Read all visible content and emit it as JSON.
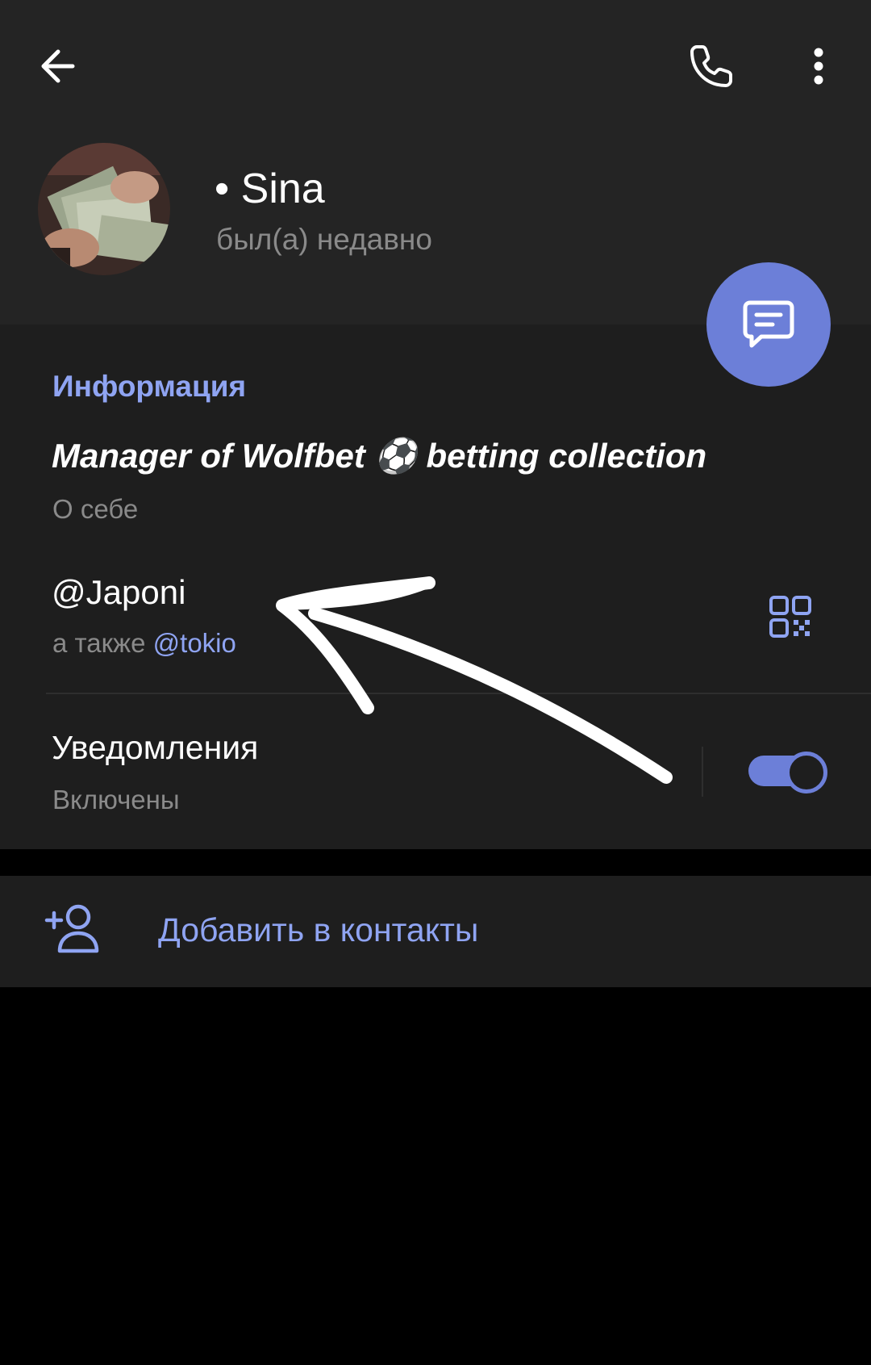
{
  "header": {
    "back_icon": "arrow-left-icon",
    "call_icon": "phone-icon",
    "more_icon": "more-vert-icon",
    "name": "• Sina",
    "status": "был(а) недавно",
    "avatar": "profile photo (hands holding dollar bills)"
  },
  "fab": {
    "icon": "message-icon"
  },
  "info": {
    "section_title": "Информация",
    "bio": "Manager of Wolfbet ⚽ betting collection",
    "bio_label": "О себе",
    "username": "@Japoni",
    "also_prefix": "а также ",
    "also_username": "@tokio",
    "qr_icon": "qr-code-icon",
    "notifications_title": "Уведомления",
    "notifications_status": "Включены",
    "notifications_enabled": true
  },
  "add_contact": {
    "icon": "add-user-icon",
    "label": "Добавить в контакты"
  },
  "colors": {
    "accent": "#6c7fd8",
    "accent_text": "#8fa4f2",
    "header_bg": "#242424",
    "section_bg": "#1e1e1e",
    "page_bg": "#000000",
    "muted_text": "#8a8a8a"
  }
}
